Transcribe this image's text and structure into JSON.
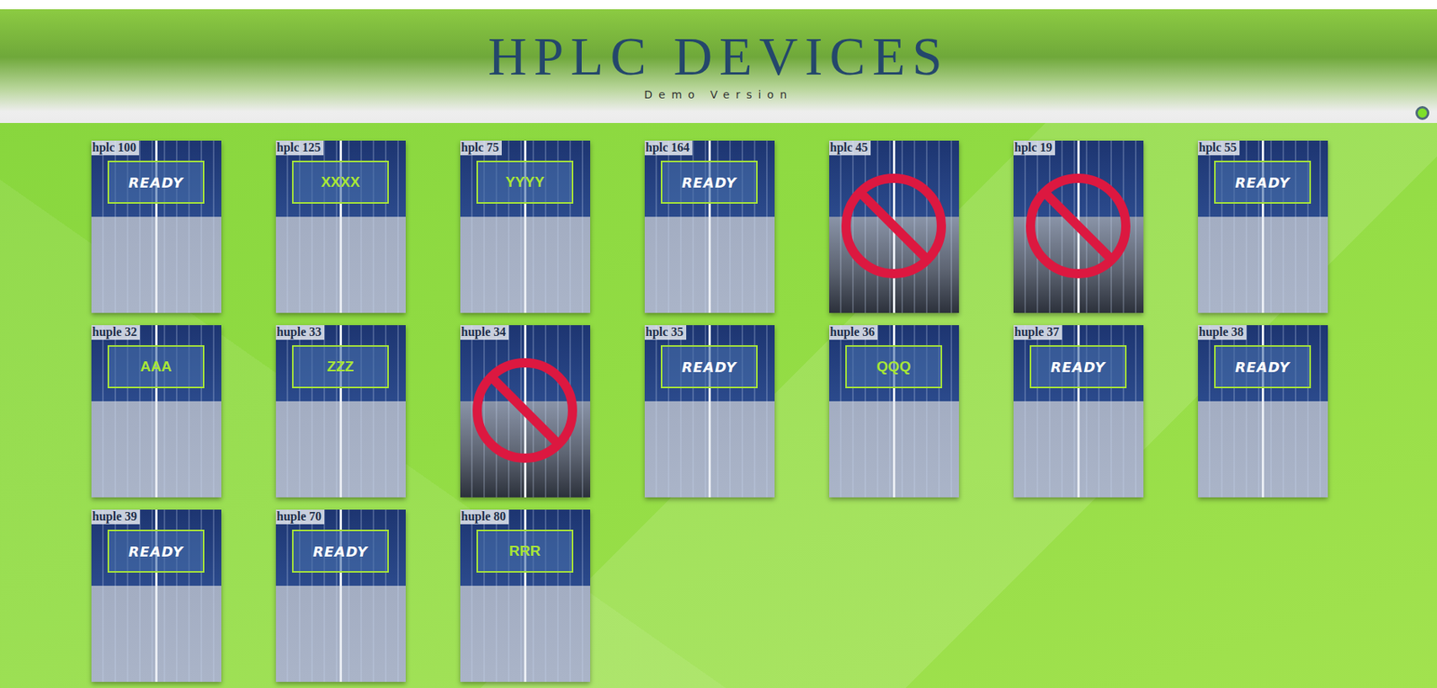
{
  "header": {
    "title": "HPLC DEVICES",
    "subtitle": "Demo Version",
    "online": true
  },
  "devices": [
    {
      "name": "hplc 100",
      "kind": "ready",
      "status": "READY"
    },
    {
      "name": "hplc 125",
      "kind": "busy",
      "status": "XXXX"
    },
    {
      "name": "hplc 75",
      "kind": "busy",
      "status": "YYYY"
    },
    {
      "name": "hplc 164",
      "kind": "ready",
      "status": "READY"
    },
    {
      "name": "hplc 45",
      "kind": "disabled",
      "status": ""
    },
    {
      "name": "hplc 19",
      "kind": "disabled",
      "status": ""
    },
    {
      "name": "hplc 55",
      "kind": "ready",
      "status": "READY"
    },
    {
      "name": "huple 32",
      "kind": "busy",
      "status": "AAA"
    },
    {
      "name": "huple 33",
      "kind": "busy",
      "status": "ZZZ"
    },
    {
      "name": "huple 34",
      "kind": "disabled",
      "status": ""
    },
    {
      "name": "hplc 35",
      "kind": "ready",
      "status": "READY"
    },
    {
      "name": "huple 36",
      "kind": "busy",
      "status": "QQQ"
    },
    {
      "name": "huple 37",
      "kind": "ready",
      "status": "READY"
    },
    {
      "name": "huple 38",
      "kind": "ready",
      "status": "READY"
    },
    {
      "name": "huple 39",
      "kind": "ready",
      "status": "READY"
    },
    {
      "name": "huple 70",
      "kind": "ready",
      "status": "READY"
    },
    {
      "name": "huple 80",
      "kind": "busy",
      "status": "RRR"
    }
  ]
}
